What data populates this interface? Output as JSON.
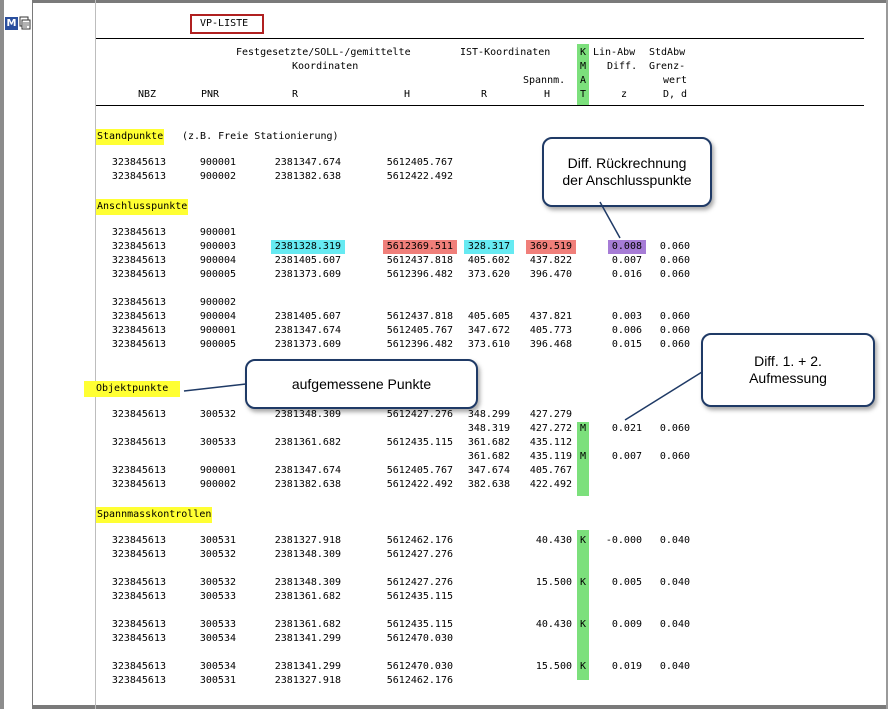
{
  "toolbar": {
    "icon_m": "M"
  },
  "title": "VP-LISTE",
  "header": {
    "row1_a": "Festgesetzte/SOLL-/gemittelte",
    "row1_b": "IST-Koordinaten",
    "row1_k": "K",
    "row1_lin": "Lin-Abw",
    "row1_std": "StdAbw",
    "row2_a": "Koordinaten",
    "row2_m": "M",
    "row2_diff": "Diff.",
    "row2_grenz": "Grenz-",
    "row3_spann": "Spannm.",
    "row3_a": "A",
    "row3_wert": "wert",
    "row4_nbz": "NBZ",
    "row4_pnr": "PNR",
    "row4_r": "R",
    "row4_h": "H",
    "row4_r2": "R",
    "row4_h2": "H",
    "row4_t": "T",
    "row4_z": "z",
    "row4_d": "D, d"
  },
  "sections": {
    "standpunkte": "Standpunkte",
    "standpunkte_note": "(z.B. Freie Stationierung)",
    "anschlusspunkte": "Anschlusspunkte",
    "objektpunkte": "Objektpunkte",
    "spannmass": "Spannmasskontrollen"
  },
  "rows": [
    {
      "nbz": "323845613",
      "pnr": "900001",
      "r": "2381347.674",
      "h": "5612405.767",
      "ir": "",
      "ih": "",
      "k": "",
      "z": "",
      "d": ""
    },
    {
      "nbz": "323845613",
      "pnr": "900002",
      "r": "2381382.638",
      "h": "5612422.492",
      "ir": "",
      "ih": "",
      "k": "",
      "z": "",
      "d": ""
    },
    {
      "nbz": "323845613",
      "pnr": "900001",
      "r": "",
      "h": "",
      "ir": "",
      "ih": "",
      "k": "",
      "z": "",
      "d": ""
    },
    {
      "nbz": "323845613",
      "pnr": "900003",
      "r": "2381328.319",
      "h": "5612369.511",
      "ir": "328.317",
      "ih": "369.519",
      "k": "",
      "z": "0.008",
      "d": "0.060"
    },
    {
      "nbz": "323845613",
      "pnr": "900004",
      "r": "2381405.607",
      "h": "5612437.818",
      "ir": "405.602",
      "ih": "437.822",
      "k": "",
      "z": "0.007",
      "d": "0.060"
    },
    {
      "nbz": "323845613",
      "pnr": "900005",
      "r": "2381373.609",
      "h": "5612396.482",
      "ir": "373.620",
      "ih": "396.470",
      "k": "",
      "z": "0.016",
      "d": "0.060"
    },
    {
      "nbz": "323845613",
      "pnr": "900002",
      "r": "",
      "h": "",
      "ir": "",
      "ih": "",
      "k": "",
      "z": "",
      "d": ""
    },
    {
      "nbz": "323845613",
      "pnr": "900004",
      "r": "2381405.607",
      "h": "5612437.818",
      "ir": "405.605",
      "ih": "437.821",
      "k": "",
      "z": "0.003",
      "d": "0.060"
    },
    {
      "nbz": "323845613",
      "pnr": "900001",
      "r": "2381347.674",
      "h": "5612405.767",
      "ir": "347.672",
      "ih": "405.773",
      "k": "",
      "z": "0.006",
      "d": "0.060"
    },
    {
      "nbz": "323845613",
      "pnr": "900005",
      "r": "2381373.609",
      "h": "5612396.482",
      "ir": "373.610",
      "ih": "396.468",
      "k": "",
      "z": "0.015",
      "d": "0.060"
    },
    {
      "nbz": "323845613",
      "pnr": "300532",
      "r": "2381348.309",
      "h": "5612427.276",
      "ir": "348.299",
      "ih": "427.279",
      "k": "",
      "z": "",
      "d": ""
    },
    {
      "nbz": "",
      "pnr": "",
      "r": "",
      "h": "",
      "ir": "348.319",
      "ih": "427.272",
      "k": "M",
      "z": "0.021",
      "d": "0.060"
    },
    {
      "nbz": "323845613",
      "pnr": "300533",
      "r": "2381361.682",
      "h": "5612435.115",
      "ir": "361.682",
      "ih": "435.112",
      "k": "",
      "z": "",
      "d": ""
    },
    {
      "nbz": "",
      "pnr": "",
      "r": "",
      "h": "",
      "ir": "361.682",
      "ih": "435.119",
      "k": "M",
      "z": "0.007",
      "d": "0.060"
    },
    {
      "nbz": "323845613",
      "pnr": "900001",
      "r": "2381347.674",
      "h": "5612405.767",
      "ir": "347.674",
      "ih": "405.767",
      "k": "",
      "z": "",
      "d": ""
    },
    {
      "nbz": "323845613",
      "pnr": "900002",
      "r": "2381382.638",
      "h": "5612422.492",
      "ir": "382.638",
      "ih": "422.492",
      "k": "",
      "z": "",
      "d": ""
    },
    {
      "nbz": "323845613",
      "pnr": "300531",
      "r": "2381327.918",
      "h": "5612462.176",
      "ir": "",
      "ih": "40.430",
      "k": "K",
      "z": "-0.000",
      "d": "0.040"
    },
    {
      "nbz": "323845613",
      "pnr": "300532",
      "r": "2381348.309",
      "h": "5612427.276",
      "ir": "",
      "ih": "",
      "k": "",
      "z": "",
      "d": ""
    },
    {
      "nbz": "323845613",
      "pnr": "300532",
      "r": "2381348.309",
      "h": "5612427.276",
      "ir": "",
      "ih": "15.500",
      "k": "K",
      "z": "0.005",
      "d": "0.040"
    },
    {
      "nbz": "323845613",
      "pnr": "300533",
      "r": "2381361.682",
      "h": "5612435.115",
      "ir": "",
      "ih": "",
      "k": "",
      "z": "",
      "d": ""
    },
    {
      "nbz": "323845613",
      "pnr": "300533",
      "r": "2381361.682",
      "h": "5612435.115",
      "ir": "",
      "ih": "40.430",
      "k": "K",
      "z": "0.009",
      "d": "0.040"
    },
    {
      "nbz": "323845613",
      "pnr": "300534",
      "r": "2381341.299",
      "h": "5612470.030",
      "ir": "",
      "ih": "",
      "k": "",
      "z": "",
      "d": ""
    },
    {
      "nbz": "323845613",
      "pnr": "300534",
      "r": "2381341.299",
      "h": "5612470.030",
      "ir": "",
      "ih": "15.500",
      "k": "K",
      "z": "0.019",
      "d": "0.040"
    },
    {
      "nbz": "323845613",
      "pnr": "300531",
      "r": "2381327.918",
      "h": "5612462.176",
      "ir": "",
      "ih": "",
      "k": "",
      "z": "",
      "d": ""
    }
  ],
  "callouts": {
    "rueckrechnung": "Diff. Rückrechnung der Anschlusspunkte",
    "aufgemessen": "aufgemessene Punkte",
    "aufmessung": "Diff. 1. + 2. Aufmessung"
  },
  "colors": {
    "section_highlight": "#ffff33",
    "kmat_column": "#7ce07c",
    "r_highlight": "#66eaf2",
    "h_highlight": "#f07f7a",
    "z_highlight": "#a67cd6",
    "title_border": "#b02020",
    "callout_border": "#1f3a66"
  }
}
